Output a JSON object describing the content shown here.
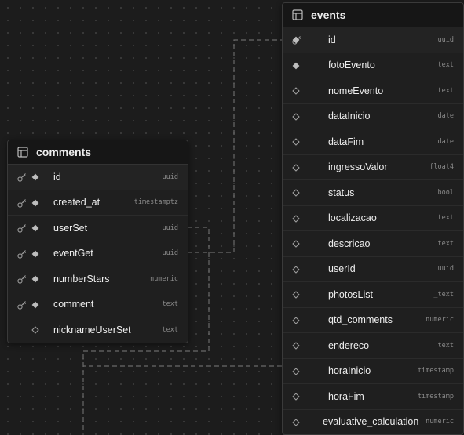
{
  "tables": {
    "comments": {
      "name": "comments",
      "columns": [
        {
          "name": "id",
          "type": "uuid",
          "primary_key": true,
          "marker": "filled"
        },
        {
          "name": "created_at",
          "type": "timestamptz",
          "primary_key": true,
          "marker": "filled"
        },
        {
          "name": "userSet",
          "type": "uuid",
          "primary_key": true,
          "marker": "filled"
        },
        {
          "name": "eventGet",
          "type": "uuid",
          "primary_key": true,
          "marker": "filled"
        },
        {
          "name": "numberStars",
          "type": "numeric",
          "primary_key": true,
          "marker": "filled"
        },
        {
          "name": "comment",
          "type": "text",
          "primary_key": true,
          "marker": "filled"
        },
        {
          "name": "nicknameUserSet",
          "type": "text",
          "primary_key": false,
          "marker": "hollow"
        }
      ]
    },
    "events": {
      "name": "events",
      "columns": [
        {
          "name": "id",
          "type": "uuid",
          "primary_key": true,
          "marker": "filled"
        },
        {
          "name": "fotoEvento",
          "type": "text",
          "primary_key": false,
          "marker": "filled"
        },
        {
          "name": "nomeEvento",
          "type": "text",
          "primary_key": false,
          "marker": "hollow"
        },
        {
          "name": "dataInicio",
          "type": "date",
          "primary_key": false,
          "marker": "hollow"
        },
        {
          "name": "dataFim",
          "type": "date",
          "primary_key": false,
          "marker": "hollow"
        },
        {
          "name": "ingressoValor",
          "type": "float4",
          "primary_key": false,
          "marker": "hollow"
        },
        {
          "name": "status",
          "type": "bool",
          "primary_key": false,
          "marker": "hollow"
        },
        {
          "name": "localizacao",
          "type": "text",
          "primary_key": false,
          "marker": "hollow"
        },
        {
          "name": "descricao",
          "type": "text",
          "primary_key": false,
          "marker": "hollow"
        },
        {
          "name": "userId",
          "type": "uuid",
          "primary_key": false,
          "marker": "hollow"
        },
        {
          "name": "photosList",
          "type": "_text",
          "primary_key": false,
          "marker": "hollow"
        },
        {
          "name": "qtd_comments",
          "type": "numeric",
          "primary_key": false,
          "marker": "hollow"
        },
        {
          "name": "endereco",
          "type": "text",
          "primary_key": false,
          "marker": "hollow"
        },
        {
          "name": "horaInicio",
          "type": "timestamp",
          "primary_key": false,
          "marker": "hollow"
        },
        {
          "name": "horaFim",
          "type": "timestamp",
          "primary_key": false,
          "marker": "hollow"
        },
        {
          "name": "evaluative_calculation",
          "type": "numeric",
          "primary_key": false,
          "marker": "hollow"
        }
      ]
    }
  },
  "relationships": [
    {
      "from": "comments.eventGet",
      "to": "events.id"
    },
    {
      "from": "comments.userSet",
      "to": "external"
    },
    {
      "from": "events.evaluative_calculation",
      "to": "external"
    }
  ],
  "colors": {
    "canvas": "#1c1c1c",
    "table_bg": "#1f1f1f",
    "header_bg": "#161616",
    "text": "#ededed",
    "type_text": "#8a8a8a",
    "connector": "#6a6a6a"
  },
  "icons": {
    "table_header": "table-grid-icon",
    "primary_key": "key-icon",
    "filled_marker": "filled-diamond-icon",
    "hollow_marker": "hollow-diamond-icon"
  }
}
